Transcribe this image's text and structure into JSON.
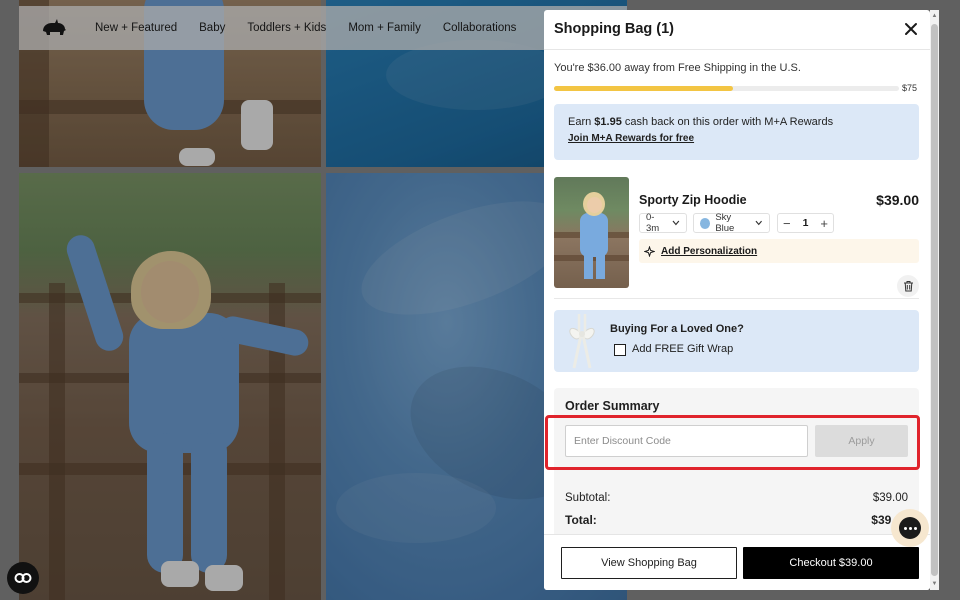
{
  "nav": {
    "logo_icon": "rhino-logo-icon",
    "items": [
      "New + Featured",
      "Baby",
      "Toddlers + Kids",
      "Mom + Family",
      "Collaborations"
    ]
  },
  "drawer": {
    "title": "Shopping Bag (1)",
    "close_icon": "close-icon",
    "shipping": {
      "message": "You're $36.00 away from Free Shipping in the U.S.",
      "progress_fraction": 0.52,
      "threshold_label": "$75"
    },
    "rewards": {
      "prefix": "Earn ",
      "amount": "$1.95",
      "suffix": " cash back on this order with M+A Rewards",
      "link": "Join M+A Rewards for free"
    },
    "item": {
      "name": "Sporty Zip Hoodie",
      "price": "$39.00",
      "size": "0-3m",
      "color": "Sky Blue",
      "color_hex": "#86b6e0",
      "quantity": "1",
      "personalization_link": "Add Personalization"
    },
    "gift": {
      "title": "Buying For a Loved One?",
      "checkbox_label": "Add FREE Gift Wrap"
    },
    "summary": {
      "title": "Order Summary",
      "discount_placeholder": "Enter Discount Code",
      "apply_label": "Apply",
      "subtotal_label": "Subtotal:",
      "subtotal_value": "$39.00",
      "total_label": "Total:",
      "total_value": "$39.00"
    },
    "footer": {
      "view_bag_label": "View Shopping Bag",
      "checkout_label": "Checkout $39.00"
    }
  },
  "colors": {
    "accent_yellow": "#f3c543",
    "info_blue": "#dce8f7",
    "highlight_red": "#e0242c"
  }
}
